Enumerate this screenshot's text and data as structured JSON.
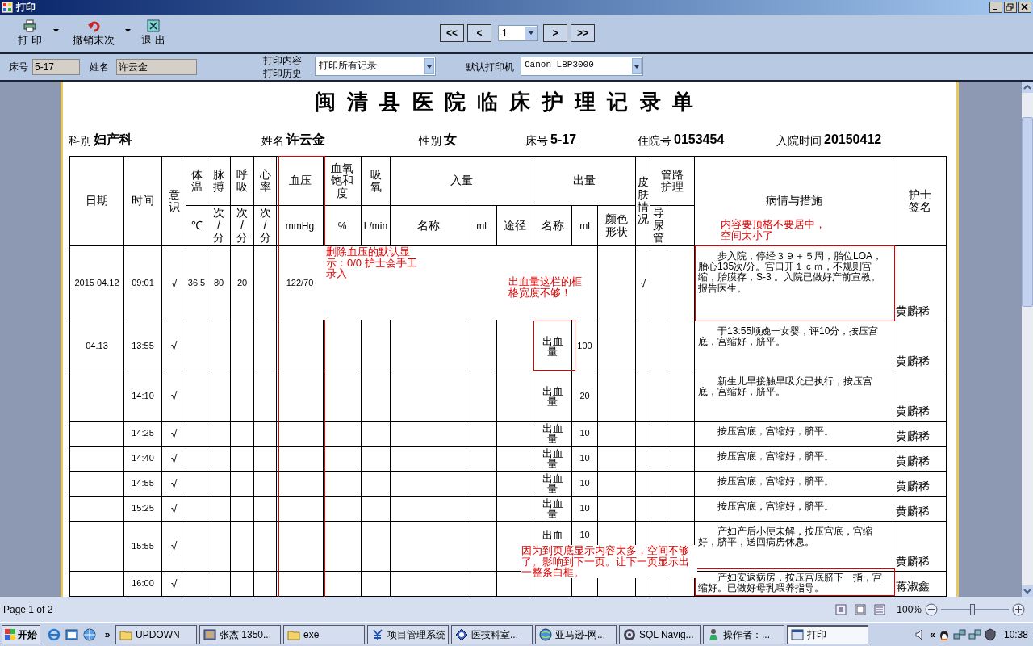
{
  "window": {
    "title": "打印"
  },
  "toolbar": {
    "buttons": [
      {
        "label": "打 印",
        "has_menu": true
      },
      {
        "label": "撤销末次",
        "has_menu": true
      },
      {
        "label": "退 出",
        "has_menu": false
      }
    ]
  },
  "pager": {
    "first": "<<",
    "prev": "<",
    "page": "1",
    "next": ">",
    "last": ">>"
  },
  "filter_bar": {
    "bed_label": "床号",
    "bed_value": "5-17",
    "name_label": "姓名",
    "name_value": "许云金",
    "content_label": "打印内容",
    "history_label": "打印历史",
    "content_value": "打印所有记录",
    "printer_label": "默认打印机",
    "printer_value": "Canon LBP3000"
  },
  "document": {
    "title": "闽清县医院临床护理记录单",
    "info": [
      {
        "label": "科别",
        "value": "妇产科"
      },
      {
        "label": "姓名",
        "value": "许云金"
      },
      {
        "label": "性别",
        "value": "女"
      },
      {
        "label": "床号",
        "value": "5-17"
      },
      {
        "label": "住院号",
        "value": "0153454"
      },
      {
        "label": "入院时间",
        "value": "20150412"
      }
    ],
    "header_row_1": [
      "日期",
      "时间",
      "意识",
      "体温",
      "脉搏",
      "呼吸",
      "心率",
      "血压",
      "血氧饱和度",
      "吸氧",
      "入量",
      "出量",
      "皮肤情况",
      "管路护理",
      "病情与措施",
      "护士签名"
    ],
    "header_row_2": [
      "℃",
      "次/分",
      "次/分",
      "次/分",
      "mmHg",
      "%",
      "L/min",
      "名称",
      "ml",
      "途径",
      "名称",
      "ml",
      "颜色形状",
      "导尿管"
    ],
    "rows": [
      {
        "date": "2015 04.12",
        "time": "09:01",
        "consciousness": "√",
        "temperature": "36.5",
        "pulse": "80",
        "respiration": "20",
        "blood_pressure": "122/70",
        "skin": "√",
        "notes": "步入院，停经３９＋５周，胎位LOA，胎心135次/分。宫口开１ｃｍ，不规则宫缩，胎膜存，S-3 。入院已做好产前宣教。报告医生。",
        "nurse": "黄麟稀"
      },
      {
        "date": "04.13",
        "time": "13:55",
        "consciousness": "√",
        "out_name": "出血量",
        "out_ml": "100",
        "notes": "于13:55顺娩一女婴，评10分，按压宫底，宫缩好，脐平。",
        "nurse": "黄麟稀"
      },
      {
        "time": "14:10",
        "consciousness": "√",
        "out_name": "出血量",
        "out_ml": "20",
        "notes": "新生儿早接触早吸允已执行，按压宫底，宫缩好，脐平。",
        "nurse": "黄麟稀"
      },
      {
        "time": "14:25",
        "consciousness": "√",
        "out_name": "出血量",
        "out_ml": "10",
        "notes": "按压宫底，宫缩好，脐平。",
        "nurse": "黄麟稀"
      },
      {
        "time": "14:40",
        "consciousness": "√",
        "out_name": "出血量",
        "out_ml": "10",
        "notes": "按压宫底，宫缩好，脐平。",
        "nurse": "黄麟稀"
      },
      {
        "time": "14:55",
        "consciousness": "√",
        "out_name": "出血量",
        "out_ml": "10",
        "notes": "按压宫底，宫缩好，脐平。",
        "nurse": "黄麟稀"
      },
      {
        "time": "15:25",
        "consciousness": "√",
        "out_name": "出血量",
        "out_ml": "10",
        "notes": "按压宫底，宫缩好，脐平。",
        "nurse": "黄麟稀"
      },
      {
        "time": "15:55",
        "consciousness": "√",
        "out_name": "出血",
        "out_ml": "10",
        "notes": "产妇产后小便未解，按压宫底，宫缩好，脐平，送回病房休息。",
        "nurse": "黄麟稀"
      },
      {
        "time": "16:00",
        "consciousness": "√",
        "notes": "产妇安返病房，按压宫底脐下一指，宫缩好。已做好母乳喂养指导。",
        "nurse": "蒋淑鑫"
      }
    ]
  },
  "annotations": [
    {
      "text": "删除血压的默认显示：0/0 护士会手工录入"
    },
    {
      "text": "出血量这栏的框格宽度不够！"
    },
    {
      "text": "内容要顶格不要居中，空间太小了"
    },
    {
      "text": "因为到页底显示内容太多，空间不够了。影响到下一页。让下一页显示出一整条白框。"
    }
  ],
  "status_bar": {
    "page": "Page 1 of 2",
    "zoom": "100%",
    "zoom_slider": {
      "level": 0.47
    }
  },
  "taskbar": {
    "start": "开始",
    "overflow": "»",
    "tasks": [
      {
        "label": "UPDOWN",
        "selected": false
      },
      {
        "label": "张杰 1350...",
        "selected": false
      },
      {
        "label": "exe",
        "selected": false
      },
      {
        "label": "项目管理系统",
        "selected": false
      },
      {
        "label": "医技科室...",
        "selected": false
      },
      {
        "label": "亚马逊-网...",
        "selected": false
      },
      {
        "label": "SQL Navig...",
        "selected": false
      },
      {
        "label": "操作者：...",
        "selected": false
      },
      {
        "label": "打印",
        "selected": true
      }
    ],
    "tray_expand": "«",
    "clock": "10:38"
  }
}
